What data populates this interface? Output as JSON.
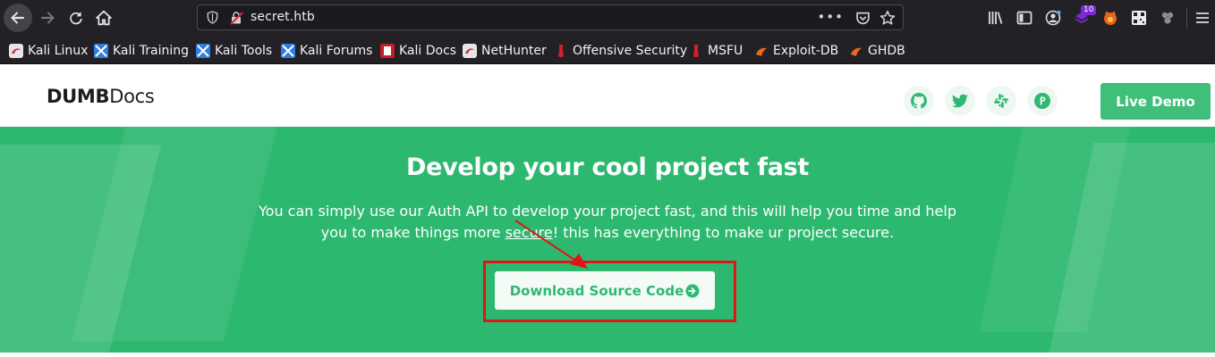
{
  "browser": {
    "url": "secret.htb",
    "page_actions": "•••",
    "extension_badge": "10",
    "bookmarks": [
      {
        "label": "Kali Linux",
        "icon": "kali-dragon-icon"
      },
      {
        "label": "Kali Training",
        "icon": "kali-training-icon"
      },
      {
        "label": "Kali Tools",
        "icon": "kali-tools-icon"
      },
      {
        "label": "Kali Forums",
        "icon": "kali-forums-icon"
      },
      {
        "label": "Kali Docs",
        "icon": "kali-docs-icon"
      },
      {
        "label": "NetHunter",
        "icon": "nethunter-icon"
      },
      {
        "label": "Offensive Security",
        "icon": "offsec-icon"
      },
      {
        "label": "MSFU",
        "icon": "msfu-icon"
      },
      {
        "label": "Exploit-DB",
        "icon": "exploit-db-icon"
      },
      {
        "label": "GHDB",
        "icon": "ghdb-icon"
      }
    ]
  },
  "site": {
    "logo_bold": "DUMB",
    "logo_light": "Docs",
    "social_icons": [
      "github-icon",
      "twitter-icon",
      "slack-icon",
      "product-hunt-icon"
    ],
    "live_demo_label": "Live Demo"
  },
  "hero": {
    "title": "Develop your cool project fast",
    "text_part1": "You can simply use our Auth API to develop your project fast, and this will help you time and help you to make things more ",
    "text_link": "secure",
    "text_part2": "! this has everything to make ur project secure.",
    "download_label": "Download Source Code"
  },
  "colors": {
    "hero_green": "#2db870",
    "button_green": "#3fbf7a",
    "annotation_red": "#e01515",
    "chrome_dark": "#232125"
  }
}
